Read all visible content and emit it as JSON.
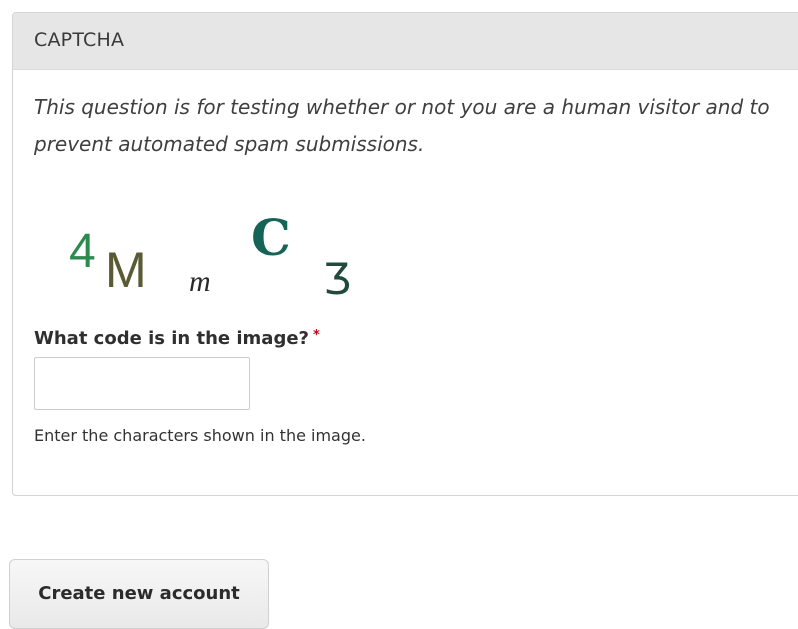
{
  "captcha": {
    "legend": "CAPTCHA",
    "description": "This question is for testing whether or not you are a human visitor and to prevent automated spam submissions.",
    "image_code": [
      "4",
      "M",
      "m",
      "C",
      "Ʒ"
    ],
    "image_colors": [
      "#2d8a4e",
      "#5a5a35",
      "#2a2a2a",
      "#166458",
      "#1f4a3c"
    ],
    "field_label": "What code is in the image?",
    "required_mark": "*",
    "input_value": "",
    "help_text": "Enter the characters shown in the image."
  },
  "form": {
    "submit_label": "Create new account"
  }
}
